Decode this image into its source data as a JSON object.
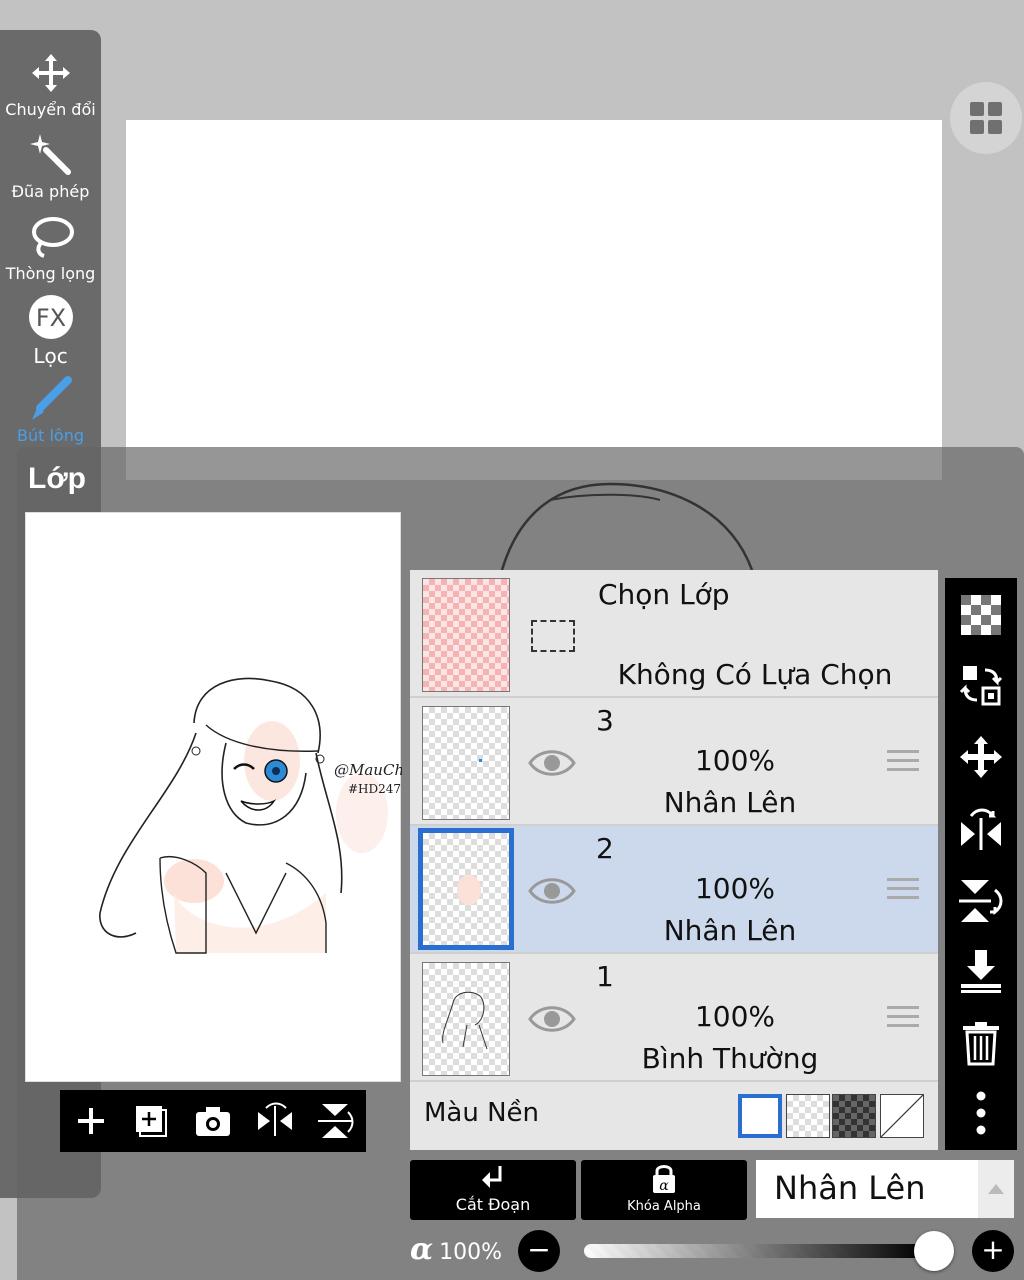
{
  "toolbar": {
    "items": [
      {
        "label": "Chuyển đổi",
        "icon": "move-arrows-icon"
      },
      {
        "label": "Đũa phép",
        "icon": "magic-wand-icon"
      },
      {
        "label": "Thòng lọng",
        "icon": "lasso-icon"
      },
      {
        "label": "Lọc",
        "icon": "fx-filter-icon"
      },
      {
        "label": "Bút lông",
        "icon": "brush-icon",
        "active": true
      }
    ]
  },
  "panel": {
    "title": "Lớp"
  },
  "selection_row": {
    "title": "Chọn Lớp",
    "status": "Không Có Lựa Chọn"
  },
  "layers": [
    {
      "number": "3",
      "opacity": "100%",
      "blend": "Nhân Lên",
      "selected": false
    },
    {
      "number": "2",
      "opacity": "100%",
      "blend": "Nhân Lên",
      "selected": true
    },
    {
      "number": "1",
      "opacity": "100%",
      "blend": "Bình Thường",
      "selected": false
    }
  ],
  "background": {
    "label": "Màu Nền"
  },
  "preview": {
    "signature": "@MauChen",
    "tag": "#HD247"
  },
  "bottom": {
    "clip_label": "Cắt Đoạn",
    "alpha_lock_label": "Khóa Alpha",
    "blend_mode": "Nhân Lên",
    "opacity_symbol": "α",
    "opacity_value": "100%",
    "minus": "−",
    "plus": "+"
  },
  "colors": {
    "accent": "#2a6fd0",
    "active_tool": "#4a9fe6",
    "selected_row": "#ccd9ec"
  }
}
